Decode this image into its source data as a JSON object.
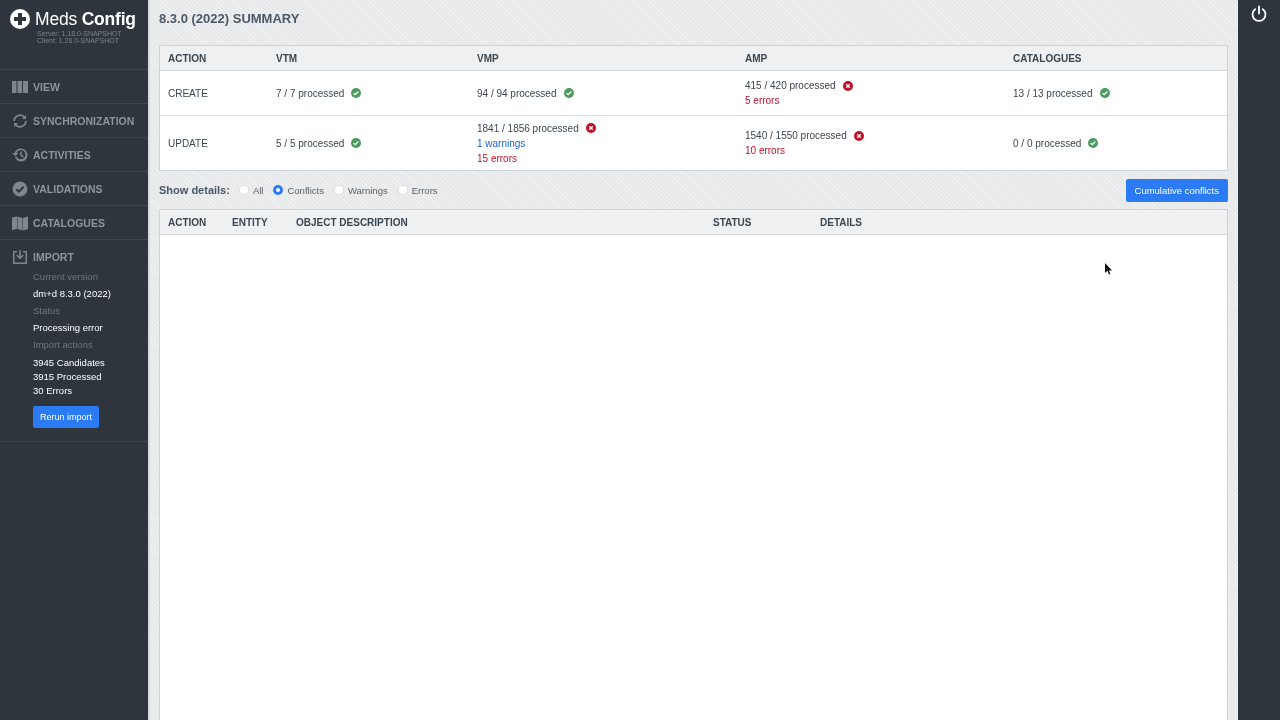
{
  "sidebar": {
    "logo": "Meds **Config**",
    "versions": [
      "Server: 1.18.0-SNAPSHOT",
      "Client: 1.26.0-SNAPSHOT"
    ],
    "items": [
      {
        "label": "VIEW",
        "expanded": false
      },
      {
        "label": "SYNCHRONIZATION",
        "expanded": false
      },
      {
        "label": "ACTIVITIES",
        "expanded": false
      },
      {
        "label": "VALIDATIONS",
        "expanded": false
      },
      {
        "label": "CATALOGUES",
        "expanded": false
      },
      {
        "label": "IMPORT",
        "expanded": true
      }
    ],
    "import_panel": {
      "fields": [
        {
          "label": "Current version",
          "values": [
            "dm+d 8.3.0 (2022)"
          ]
        },
        {
          "label": "Status",
          "values": [
            "Processing error"
          ]
        },
        {
          "label": "Import actions",
          "values": [
            "3945 Candidates",
            "3915 Processed",
            "30 Errors"
          ]
        }
      ],
      "button": "Rerun import"
    }
  },
  "title": "8.3.0 (2022) SUMMARY",
  "summary_table": {
    "columns": [
      "ACTION",
      "VTM",
      "VMP",
      "AMP",
      "CATALOGUES"
    ],
    "rows": [
      {
        "cells": [
          {
            "text": "CREATE"
          },
          {
            "text": "7 / 7 processed",
            "failed": false
          },
          {
            "text": "94 / 94 processed",
            "failed": false
          },
          {
            "text": "415 / 420 processed",
            "failed": true,
            "notes": [
              {
                "text": "5 errors",
                "kind": "error"
              }
            ]
          },
          {
            "text": "13 / 13 processed",
            "failed": false
          }
        ]
      },
      {
        "cells": [
          {
            "text": "UPDATE"
          },
          {
            "text": "5 / 5 processed",
            "failed": false
          },
          {
            "text": "1841 / 1856 processed",
            "failed": true,
            "notes": [
              {
                "text": "1 warnings",
                "kind": "warning"
              },
              {
                "text": "15 errors",
                "kind": "error"
              }
            ]
          },
          {
            "text": "1540 / 1550 processed",
            "failed": true,
            "notes": [
              {
                "text": "10 errors",
                "kind": "error"
              }
            ]
          },
          {
            "text": "0 / 0 processed",
            "failed": false
          }
        ]
      }
    ]
  },
  "details_filter": {
    "label": "Show details:",
    "options": [
      {
        "label": "All",
        "selected": false
      },
      {
        "label": "Conflicts",
        "selected": true
      },
      {
        "label": "Warnings",
        "selected": false
      },
      {
        "label": "Errors",
        "selected": false
      }
    ],
    "button": "Cumulative conflicts"
  },
  "details_table": {
    "columns": [
      "ACTION",
      "ENTITY",
      "OBJECT DESCRIPTION",
      "STATUS",
      "DETAILS"
    ]
  }
}
